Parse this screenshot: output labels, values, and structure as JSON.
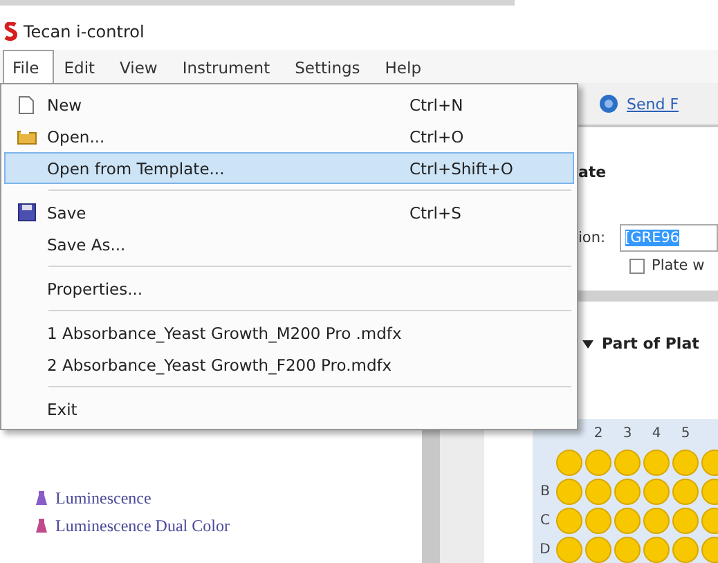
{
  "window": {
    "title": "Tecan i-control"
  },
  "menu_bar": [
    {
      "label": "File",
      "selected": true
    },
    {
      "label": "Edit",
      "selected": false
    },
    {
      "label": "View",
      "selected": false
    },
    {
      "label": "Instrument",
      "selected": false
    },
    {
      "label": "Settings",
      "selected": false
    },
    {
      "label": "Help",
      "selected": false
    }
  ],
  "file_menu": [
    {
      "kind": "item",
      "label": "New",
      "shortcut": "Ctrl+N",
      "selected": false
    },
    {
      "kind": "item",
      "label": "Open...",
      "shortcut": "Ctrl+O",
      "selected": false
    },
    {
      "kind": "item",
      "label": "Open from Template...",
      "shortcut": "Ctrl+Shift+O",
      "selected": true
    },
    {
      "kind": "separator"
    },
    {
      "kind": "item",
      "label": "Save",
      "shortcut": "Ctrl+S",
      "selected": false
    },
    {
      "kind": "item",
      "label": "Save As...",
      "selected": false
    },
    {
      "kind": "separator"
    },
    {
      "kind": "item",
      "label": "Properties...",
      "selected": false
    },
    {
      "kind": "separator"
    },
    {
      "kind": "item",
      "label": "1 Absorbance_Yeast Growth_M200 Pro .mdfx",
      "selected": false
    },
    {
      "kind": "item",
      "label": "2 Absorbance_Yeast Growth_F200 Pro.mdfx",
      "selected": false
    },
    {
      "kind": "separator"
    },
    {
      "kind": "item",
      "label": "Exit",
      "selected": false
    }
  ],
  "toolbar": {
    "link": "Send F"
  },
  "panel": {
    "heading": "ate",
    "field_label": "ion:",
    "field_value": "[GRE96",
    "checkbox": {
      "label": "Plate w",
      "checked": false
    }
  },
  "section": {
    "label": "Part of Plat",
    "expanded": true
  },
  "plate": {
    "columns": [
      "2",
      "3",
      "4",
      "5"
    ],
    "rows": [
      "B",
      "C",
      "D"
    ]
  },
  "tree": [
    {
      "label": "Luminescence"
    },
    {
      "label": "Luminescence Dual Color"
    }
  ]
}
